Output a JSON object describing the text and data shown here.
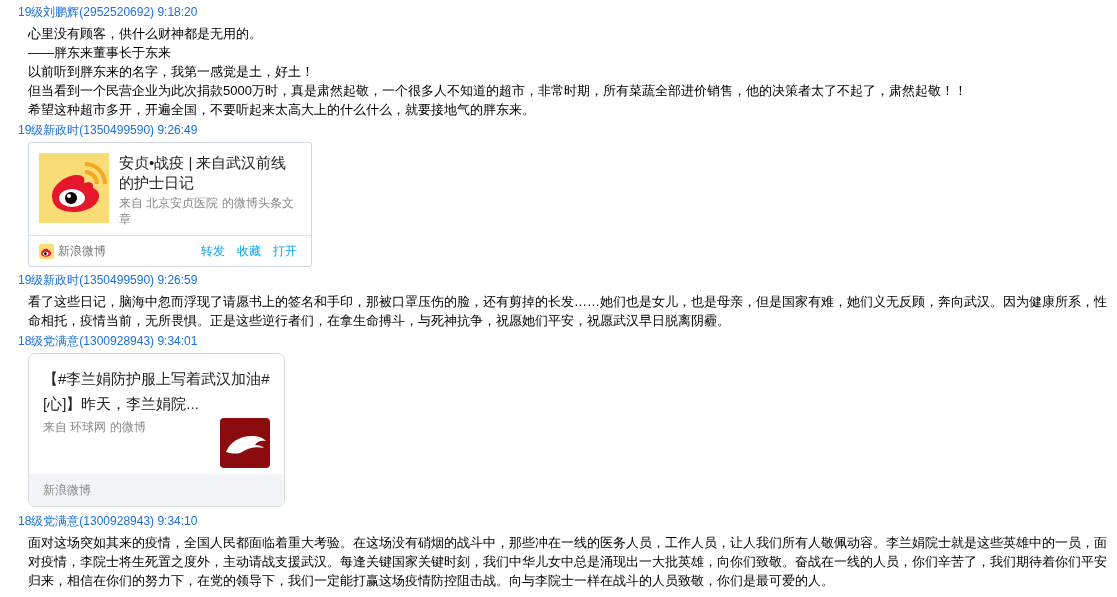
{
  "messages": [
    {
      "sender": "19级刘鹏辉(2952520692) 9:18:20",
      "kind": "lines",
      "lines": [
        "心里没有顾客，供什么财神都是无用的。",
        "——胖东来董事长于东来",
        "以前听到胖东来的名字，我第一感觉是土，好土！",
        "但当看到一个民营企业为此次捐款5000万时，真是肃然起敬，一个很多人不知道的超市，非常时期，所有菜蔬全部进价销售，他的决策者太了不起了，肃然起敬！！",
        "希望这种超市多开，开遍全国，不要听起来太高大上的什么什么，就要接地气的胖东来。"
      ]
    },
    {
      "sender": "19级新政时(1350499590) 9:26:49",
      "kind": "article_card",
      "title": "安贞•战疫 | 来自武汉前线的护士日记",
      "source": "来自 北京安贞医院 的微博头条文章",
      "app": "新浪微博",
      "actions": [
        "转发",
        "收藏",
        "打开"
      ]
    },
    {
      "sender": "19级新政时(1350499590) 9:26:59",
      "kind": "paragraph",
      "text": "看了这些日记，脑海中忽而浮现了请愿书上的签名和手印，那被口罩压伤的脸，还有剪掉的长发……她们也是女儿，也是母亲，但是国家有难，她们义无反顾，奔向武汉。因为健康所系，性命相托，疫情当前，无所畏惧。正是这些逆行者们，在拿生命搏斗，与死神抗争，祝愿她们平安，祝愿武汉早日脱离阴霾。"
    },
    {
      "sender": "18级党满意(1300928943) 9:34:01",
      "kind": "share_card",
      "title": "【#李兰娟防护服上写着武汉加油#[心]】昨天，李兰娟院...",
      "source": "来自 环球网 的微博",
      "app": "新浪微博"
    },
    {
      "sender": "18级党满意(1300928943) 9:34:10",
      "kind": "paragraph",
      "text": "面对这场突如其来的疫情，全国人民都面临着重大考验。在这场没有硝烟的战斗中，那些冲在一线的医务人员，工作人员，让人我们所有人敬佩动容。李兰娟院士就是这些英雄中的一员，面对疫情，李院士将生死置之度外，主动请战支援武汉。每逢关键国家关键时刻，我们中华儿女中总是涌现出一大批英雄，向你们致敬。奋战在一线的人员，你们辛苦了，我们期待着你们平安归来，相信在你们的努力下，在党的领导下，我们一定能打赢这场疫情防控阻击战。向与李院士一样在战斗的人员致敬，你们是最可爱的人。"
    }
  ]
}
